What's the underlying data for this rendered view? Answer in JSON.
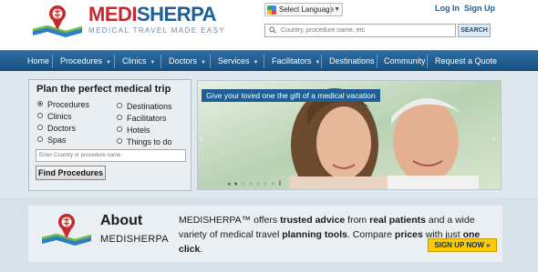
{
  "header": {
    "brand_part1": "MEDI",
    "brand_part2": "SHERPA",
    "tagline": "MEDICAL TRAVEL MADE EASY",
    "language_label": "Select Language",
    "login_label": "Log In",
    "signup_label": "Sign Up",
    "search_placeholder": "Country, procedure name, etc",
    "search_button": "SEARCH"
  },
  "nav": {
    "items": [
      {
        "label": "Home",
        "dropdown": false
      },
      {
        "label": "Procedures",
        "dropdown": true
      },
      {
        "label": "Clinics",
        "dropdown": true
      },
      {
        "label": "Doctors",
        "dropdown": true
      },
      {
        "label": "Services",
        "dropdown": true
      },
      {
        "label": "Facilitators",
        "dropdown": true
      },
      {
        "label": "Destinations",
        "dropdown": false
      },
      {
        "label": "Community",
        "dropdown": false
      },
      {
        "label": "Request a Quote",
        "dropdown": false
      }
    ]
  },
  "plan": {
    "title": "Plan the perfect medical trip",
    "options_left": [
      "Procedures",
      "Clinics",
      "Doctors",
      "Spas"
    ],
    "options_right": [
      "Destinations",
      "Facilitators",
      "Hotels",
      "Things to do"
    ],
    "selected": "Procedures",
    "input_placeholder": "Enter Country or procedure name",
    "button_label": "Find Procedures"
  },
  "hero": {
    "banner_text": "Give your loved one the gift of a medical vacation",
    "prev_arrow": "‹",
    "next_arrow": "›",
    "slide_dots": "◂ ● ○ ○ ○ ○ ○ ‖"
  },
  "about": {
    "title": "About",
    "subtitle": "MEDISHERPA",
    "text_parts": [
      {
        "t": "MEDISHERPA™ offers ",
        "b": false
      },
      {
        "t": "trusted advice",
        "b": true
      },
      {
        "t": " from ",
        "b": false
      },
      {
        "t": "real patients",
        "b": true
      },
      {
        "t": " and a wide variety of medical travel ",
        "b": false
      },
      {
        "t": "planning tools",
        "b": true
      },
      {
        "t": ". Compare ",
        "b": false
      },
      {
        "t": "prices",
        "b": true
      },
      {
        "t": " with just ",
        "b": false
      },
      {
        "t": "one click",
        "b": true
      },
      {
        "t": ".",
        "b": false
      }
    ],
    "signup_button": "SIGN UP NOW »"
  },
  "colors": {
    "brand_red": "#c7282b",
    "brand_blue": "#1e5f95",
    "nav_blue": "#17507f",
    "cta_yellow": "#ffcc00"
  }
}
